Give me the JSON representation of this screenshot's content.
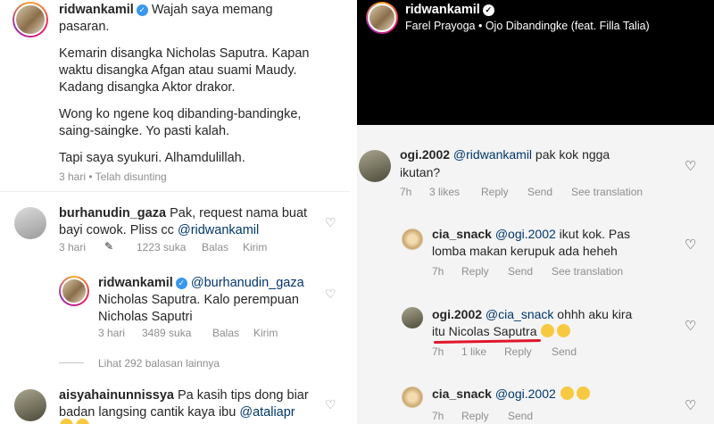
{
  "left": {
    "post": {
      "username": "ridwankamil",
      "line1": "Wajah saya memang",
      "line2": "pasaran.",
      "para2_l1": "Kemarin disangka Nicholas Saputra. Kapan",
      "para2_l2": "waktu disangka Afgan atau suami Maudy.",
      "para2_l3": "Kadang disangka Aktor drakor.",
      "para3_l1": "Wong ko ngene koq dibanding-bandingke,",
      "para3_l2": "saing-saingke. Yo pasti kalah.",
      "para4": "Tapi saya syukuri. Alhamdulillah.",
      "meta": "3 hari • Telah disunting"
    },
    "comment1": {
      "username": "burhanudin_gaza",
      "text_l1": "Pak, request nama buat",
      "text_l2_prefix": "bayi cowok. Pliss cc ",
      "mention": "@ridwankamil",
      "time": "3 hari",
      "likes": "1223 suka",
      "reply": "Balas",
      "send": "Kirim"
    },
    "reply1": {
      "username": "ridwankamil",
      "mention": "@burhanudin_gaza",
      "text_l1": "Nicholas Saputra. Kalo perempuan",
      "text_l2": "Nicholas Saputri",
      "time": "3 hari",
      "likes": "3489 suka",
      "reply": "Balas",
      "send": "Kirim"
    },
    "view_more": "Lihat 292 balasan lainnya",
    "comment2": {
      "username": "aisyahainunnissya",
      "text_l1": "Pa kasih tips dong biar",
      "text_l2_prefix": "badan langsing cantik kaya ibu ",
      "mention": "@ataliapr"
    }
  },
  "right": {
    "header": {
      "username": "ridwankamil",
      "song": "Farel Prayoga • Ojo Dibandingke (feat. Filla Talia)"
    },
    "c1": {
      "username": "ogi.2002",
      "mention": "@ridwankamil",
      "text_rest": " pak kok ngga",
      "text_l2": "ikutan?",
      "time": "7h",
      "likes": "3 likes",
      "reply": "Reply",
      "send": "Send",
      "translate": "See translation"
    },
    "c2": {
      "username": "cia_snack",
      "mention": "@ogi.2002",
      "text_rest": " ikut kok. Pas",
      "text_l2": "lomba makan kerupuk ada heheh",
      "time": "7h",
      "reply": "Reply",
      "send": "Send",
      "translate": "See translation"
    },
    "c3": {
      "username": "ogi.2002",
      "mention": "@cia_snack",
      "text_rest": " ohhh aku kira",
      "text_l2": "itu Nicolas Saputra",
      "time": "7h",
      "likes": "1 like",
      "reply": "Reply",
      "send": "Send"
    },
    "c4": {
      "username": "cia_snack",
      "mention": "@ogi.2002",
      "time": "7h",
      "reply": "Reply",
      "send": "Send"
    }
  },
  "colors": {
    "mention": "#00376b",
    "verified": "#3897f0",
    "annotation": "#e0162b"
  }
}
